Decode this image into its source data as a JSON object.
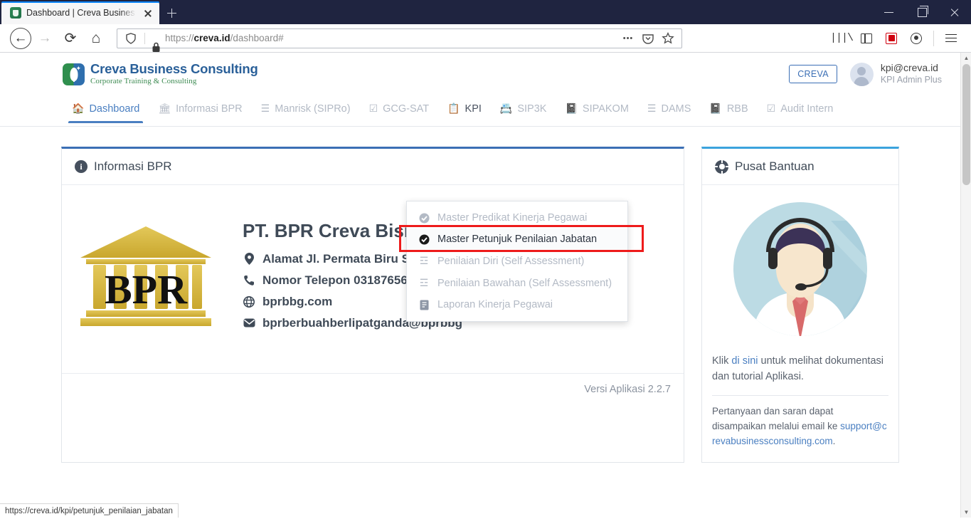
{
  "browser": {
    "tab_title": "Dashboard | Creva Business Co",
    "url_display_prefix": "https://",
    "url_domain": "creva.id",
    "url_path": "/dashboard#",
    "status_link": "https://creva.id/kpi/petunjuk_penilaian_jabatan",
    "icons": {
      "back": "back-arrow-icon",
      "forward": "forward-arrow-icon",
      "reload": "reload-icon",
      "home": "home-icon",
      "shield": "tracking-protection-shield-icon",
      "lock": "padlock-icon",
      "page_actions": "ellipsis-icon",
      "pocket": "pocket-icon",
      "bookmark": "star-icon",
      "library": "library-icon",
      "sidebar": "sidebar-icon",
      "extension": "extension-icon",
      "account": "account-icon",
      "menu": "hamburger-menu-icon",
      "new_tab": "plus-icon",
      "close_tab": "close-icon",
      "minimize": "minimize-icon",
      "maximize": "maximize-icon",
      "close_window": "window-close-icon"
    }
  },
  "header": {
    "logo_title": "Creva Business Consulting",
    "logo_subtitle": "Corporate Training & Consulting",
    "org_button": "CREVA",
    "user_email": "kpi@creva.id",
    "user_role": "KPI Admin Plus"
  },
  "nav": {
    "items": [
      {
        "label": "Dashboard",
        "icon": "🏠",
        "active": true
      },
      {
        "label": "Informasi BPR",
        "icon": "🏛",
        "active": false
      },
      {
        "label": "Manrisk (SIPRo)",
        "icon": "☰",
        "active": false
      },
      {
        "label": "GCG-SAT",
        "icon": "☑",
        "active": false
      },
      {
        "label": "KPI",
        "icon": "📋",
        "active": false
      },
      {
        "label": "SIP3K",
        "icon": "📇",
        "active": false
      },
      {
        "label": "SIPAKOM",
        "icon": "📓",
        "active": false
      },
      {
        "label": "DAMS",
        "icon": "☰",
        "active": false
      },
      {
        "label": "RBB",
        "icon": "📓",
        "active": false
      },
      {
        "label": "Audit Intern",
        "icon": "☑",
        "active": false
      }
    ]
  },
  "dropdown": {
    "open_for": "KPI",
    "items": [
      {
        "label": "Master Predikat Kinerja Pegawai",
        "icon": "✔",
        "highlighted": false
      },
      {
        "label": "Master Petunjuk Penilaian Jabatan",
        "icon": "✔",
        "highlighted": true
      },
      {
        "label": "Penilaian Diri (Self Assessment)",
        "icon": "☰",
        "highlighted": false
      },
      {
        "label": "Penilaian Bawahan (Self Assessment)",
        "icon": "☰",
        "highlighted": false
      },
      {
        "label": "Laporan Kinerja Pegawai",
        "icon": "📓",
        "highlighted": false
      }
    ],
    "highlight_color": "#ee1b1b"
  },
  "info_card": {
    "title": "Informasi BPR",
    "logo_text": "BPR",
    "company_name": "PT. BPR Creva Bisnis",
    "rows": [
      {
        "icon": "location-pin-icon",
        "text": "Alamat Jl. Permata Biru Sura"
      },
      {
        "icon": "phone-icon",
        "text": "Nomor Telepon 0318765632"
      },
      {
        "icon": "globe-icon",
        "text": "bprbbg.com"
      },
      {
        "icon": "envelope-icon",
        "text": "bprberbuahberlipatganda@bprbbg"
      }
    ],
    "footer": "Versi Aplikasi 2.2.7",
    "accent_color": "#3b6fb5"
  },
  "help_card": {
    "title": "Pusat Bantuan",
    "line1_pre": "Klik ",
    "line1_link": "di sini",
    "line1_post": " untuk melihat dokumentasi dan tutorial Aplikasi.",
    "line2": "Pertanyaan dan saran dapat disampaikan melalui email ke ",
    "email": "support@crevabusinessconsulting.com",
    "line2_end": ".",
    "accent_color": "#3ba3dd"
  }
}
